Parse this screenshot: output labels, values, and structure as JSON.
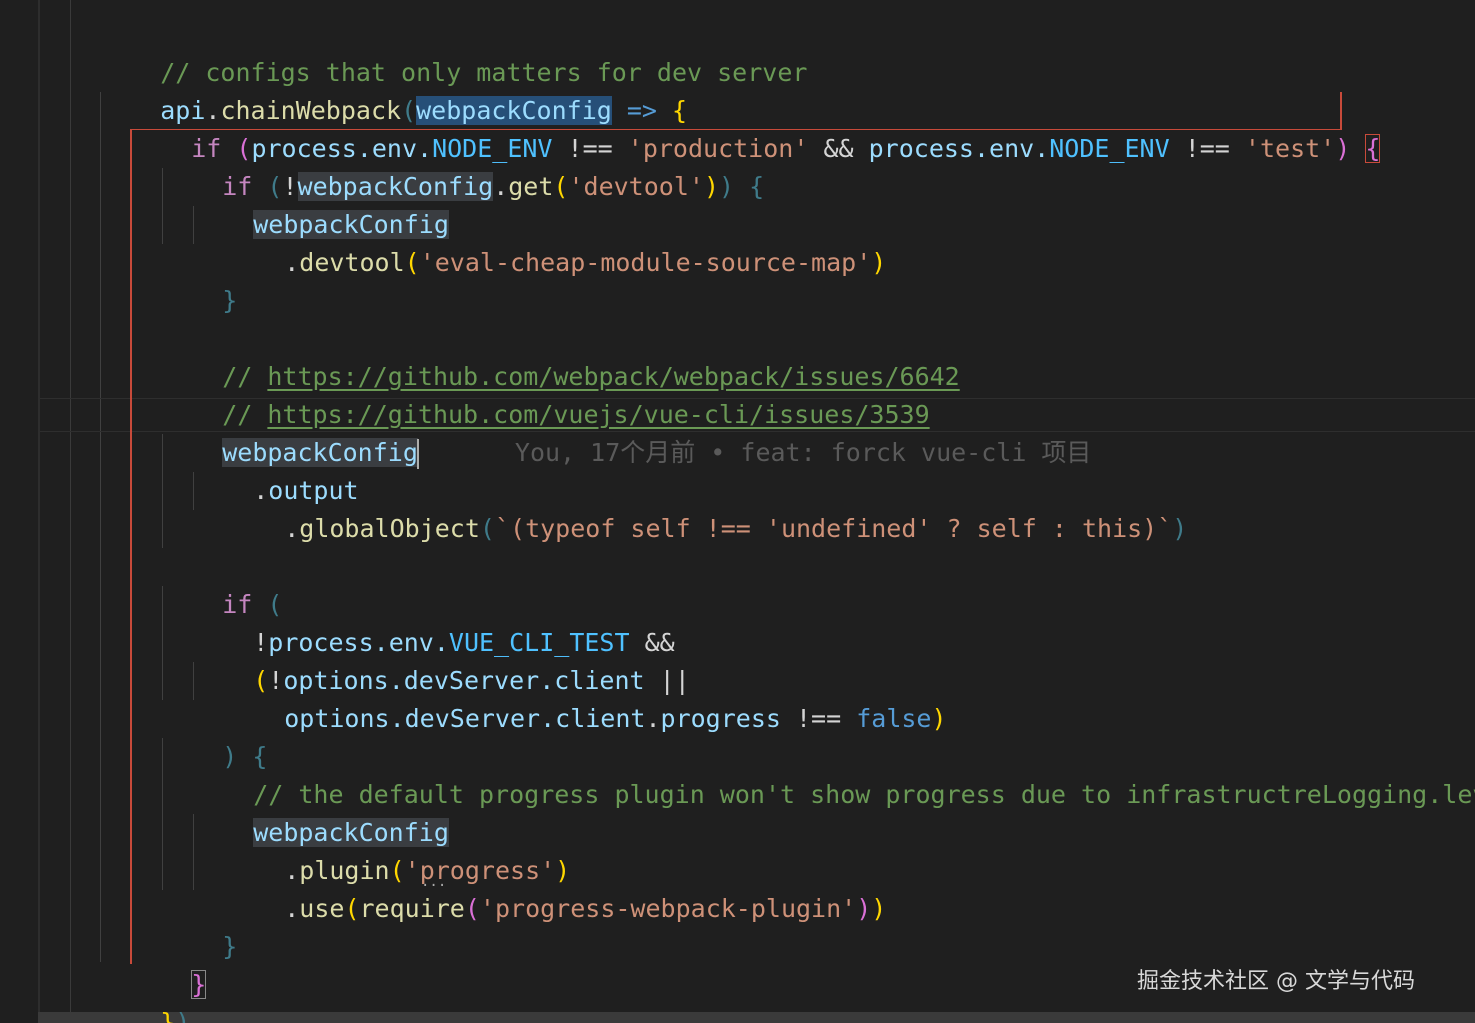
{
  "editor": {
    "lines": {
      "l1": {
        "comment": "// configs that only matters for dev server"
      },
      "l2": {
        "obj": "api",
        "dot": ".",
        "fn": "chainWebpack",
        "open": "(",
        "param": "webpackConfig",
        "arrow": " => ",
        "brace": "{"
      },
      "l3": {
        "kw": "if",
        "open": "(",
        "a": "process",
        "b": ".env.",
        "c": "NODE_ENV",
        "op1": " !== ",
        "s1": "'production'",
        "and": " && ",
        "d": "process",
        "e": ".env.",
        "f": "NODE_ENV",
        "op2": " !== ",
        "s2": "'test'",
        "close": ")",
        "brace": "{"
      },
      "l4": {
        "kw": "if",
        "open": "(",
        "bang": "!",
        "var": "webpackConfig",
        "dot": ".",
        "fn": "get",
        "p1": "(",
        "str": "'devtool'",
        "p2": ")",
        "close": ")",
        "brace": "{"
      },
      "l5": {
        "var": "webpackConfig"
      },
      "l6": {
        "dot": ".",
        "fn": "devtool",
        "p1": "(",
        "str": "'eval-cheap-module-source-map'",
        "p2": ")"
      },
      "l7": {
        "brace": "}"
      },
      "l9": {
        "slashes": "// ",
        "url": "https://github.com/webpack/webpack/issues/6642"
      },
      "l10": {
        "slashes": "// ",
        "url": "https://github.com/vuejs/vue-cli/issues/3539"
      },
      "l11": {
        "var": "webpackConfig",
        "blame": "You, 17个月前 • feat: forck vue-cli 项目"
      },
      "l12": {
        "dot": ".",
        "prop": "output"
      },
      "l13": {
        "dot": ".",
        "prop": "globalObject",
        "p1": "(",
        "tpl": "`(typeof self !== 'undefined' ? self : this)`",
        "p2": ")"
      },
      "l15": {
        "kw": "if",
        "open": "("
      },
      "l16": {
        "bang": "!",
        "a": "process",
        "b": ".env.",
        "c": "VUE_CLI_TEST",
        "and": " &&"
      },
      "l17": {
        "p1": "(",
        "bang": "!",
        "a": "options",
        "b": ".devServer.",
        "c": "client",
        "or": " ||"
      },
      "l18": {
        "a": "options",
        "b": ".devServer.",
        "c": "client",
        "d": ".",
        "e": "progress",
        "op": " !== ",
        "bool": "false",
        "p2": ")"
      },
      "l19": {
        "close": ")",
        "brace": "{"
      },
      "l20": {
        "comment": "// the default progress plugin won't show progress due to infrastructreLogging.level"
      },
      "l21": {
        "var": "webpackConfig"
      },
      "l22": {
        "dot": ".",
        "fn": "plugin",
        "p1": "(",
        "str": "'progress'",
        "p2": ")"
      },
      "l23": {
        "dot": ".",
        "fn1": "use",
        "p1": "(",
        "fn2": "require",
        "p2": "(",
        "str": "'progress-webpack-plugin'",
        "p3": ")",
        "p4": ")"
      },
      "l24": {
        "brace": "}"
      },
      "l25": {
        "brace": "}"
      },
      "l26": {
        "brace": "}",
        "paren": ")"
      }
    }
  },
  "watermark": {
    "text": "掘金技术社区 @ 文学与代码"
  },
  "colors": {
    "background": "#1f1f1f",
    "comment": "#6a9955",
    "keyword": "#c586c0",
    "function": "#dcdcaa",
    "variable": "#9cdcfe",
    "constant": "#4fc1ff",
    "string": "#ce9178",
    "bracket_gold": "#ffd700",
    "bracket_orchid": "#da70d6",
    "bracket_blue": "#179fff",
    "scope_highlight": "#c84a3a",
    "selection": "#264f78"
  }
}
